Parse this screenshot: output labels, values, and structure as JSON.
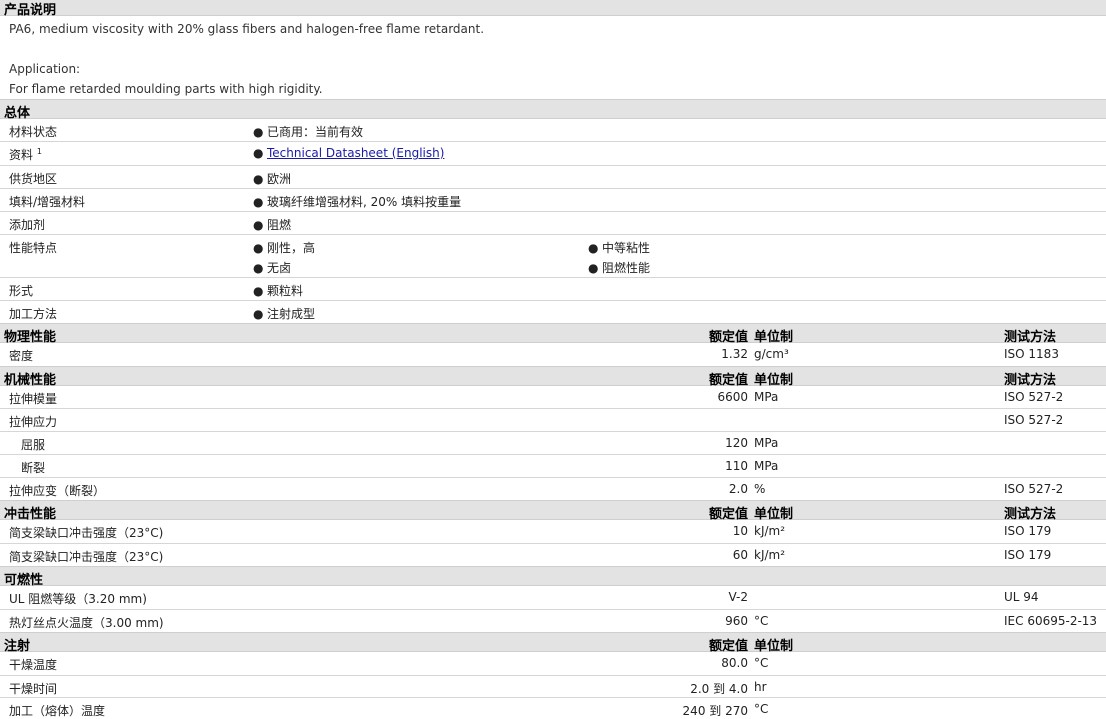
{
  "desc": {
    "title": "产品说明",
    "line1": "PA6, medium viscosity with 20% glass fibers and halogen-free flame retardant.",
    "line2": "Application:",
    "line3": "For flame retarded moulding parts with high rigidity."
  },
  "general": {
    "title": "总体",
    "rows": [
      {
        "label": "材料状态",
        "value": "已商用：当前有效"
      },
      {
        "label": "资料",
        "sup": "1",
        "value": "Technical Datasheet (English)"
      },
      {
        "label": "供货地区",
        "value": "欧洲"
      },
      {
        "label": "填料/增强材料",
        "value": "玻璃纤维增强材料, 20% 填料按重量"
      },
      {
        "label": "添加剂",
        "value": "阻燃"
      },
      {
        "label": "性能特点",
        "values": [
          "刚性，高",
          "中等粘性",
          "无卤",
          "阻燃性能"
        ]
      },
      {
        "label": "形式",
        "value": "颗粒料"
      },
      {
        "label": "加工方法",
        "value": "注射成型"
      }
    ]
  },
  "col_headers": {
    "value": "额定值",
    "unit": "单位制",
    "method": "测试方法"
  },
  "physical": {
    "title": "物理性能",
    "rows": [
      {
        "label": "密度",
        "value": "1.32",
        "unit": "g/cm³",
        "method": "ISO 1183"
      }
    ]
  },
  "mechanical": {
    "title": "机械性能",
    "rows": [
      {
        "label": "拉伸模量",
        "value": "6600",
        "unit": "MPa",
        "method": "ISO 527-2"
      },
      {
        "label": "拉伸应力",
        "value": "",
        "unit": "",
        "method": "ISO 527-2"
      },
      {
        "label": "屈服",
        "value": "120",
        "unit": "MPa",
        "method": ""
      },
      {
        "label": "断裂",
        "value": "110",
        "unit": "MPa",
        "method": ""
      },
      {
        "label": "拉伸应变（断裂）",
        "value": "2.0",
        "unit": "%",
        "method": "ISO 527-2"
      }
    ]
  },
  "impact": {
    "title": "冲击性能",
    "rows": [
      {
        "label": "简支梁缺口冲击强度（23°C)",
        "value": "10",
        "unit": "kJ/m²",
        "method": "ISO 179"
      },
      {
        "label": "简支梁缺口冲击强度（23°C)",
        "value": "60",
        "unit": "kJ/m²",
        "method": "ISO 179"
      }
    ]
  },
  "flammability": {
    "title": "可燃性",
    "rows": [
      {
        "label": "UL 阻燃等级（3.20 mm)",
        "value": "V-2",
        "unit": "",
        "method": "UL 94"
      },
      {
        "label": "热灯丝点火温度（3.00 mm)",
        "value": "960",
        "unit": "°C",
        "method": "IEC 60695-2-13"
      }
    ]
  },
  "injection": {
    "title": "注射",
    "rows": [
      {
        "label": "干燥温度",
        "value": "80.0",
        "unit": "°C",
        "method": ""
      },
      {
        "label": "干燥时间",
        "value": "2.0 到  4.0",
        "unit": "hr",
        "method": ""
      },
      {
        "label": "加工（熔体）温度",
        "value": "240 到  270",
        "unit": "°C",
        "method": ""
      }
    ]
  }
}
